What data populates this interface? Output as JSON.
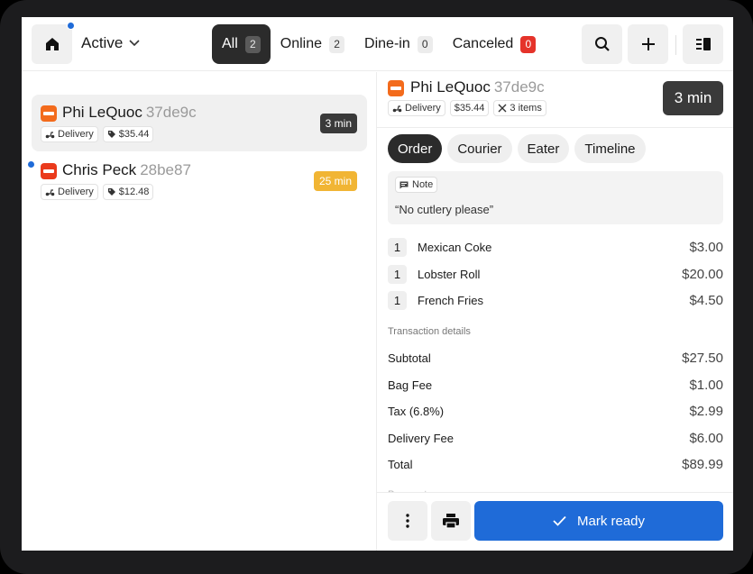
{
  "header": {
    "status_filter": "Active",
    "tabs": [
      {
        "label": "All",
        "count": "2"
      },
      {
        "label": "Online",
        "count": "2"
      },
      {
        "label": "Dine-in",
        "count": "0"
      },
      {
        "label": "Canceled",
        "count": "0"
      }
    ]
  },
  "orders": [
    {
      "name": "Phi LeQuoc",
      "code": "37de9c",
      "type": "Delivery",
      "total": "$35.44",
      "time": "3 min"
    },
    {
      "name": "Chris Peck",
      "code": "28be87",
      "type": "Delivery",
      "total": "$12.48",
      "time": "25 min"
    }
  ],
  "detail": {
    "name": "Phi LeQuoc",
    "code": "37de9c",
    "type": "Delivery",
    "total": "$35.44",
    "items_count": "3 items",
    "time": "3 min",
    "tabs": [
      "Order",
      "Courier",
      "Eater",
      "Timeline"
    ],
    "note_label": "Note",
    "note_text": "“No cutlery please”",
    "items": [
      {
        "qty": "1",
        "name": "Mexican Coke",
        "price": "$3.00"
      },
      {
        "qty": "1",
        "name": "Lobster Roll",
        "price": "$20.00"
      },
      {
        "qty": "1",
        "name": "French Fries",
        "price": "$4.50"
      }
    ],
    "transaction_title": "Transaction details",
    "transactions": [
      {
        "label": "Subtotal",
        "value": "$27.50"
      },
      {
        "label": "Bag Fee",
        "value": "$1.00"
      },
      {
        "label": "Tax (6.8%)",
        "value": "$2.99"
      },
      {
        "label": "Delivery Fee",
        "value": "$6.00"
      },
      {
        "label": "Total",
        "value": "$89.99"
      }
    ],
    "cut_off_heading": "Payment",
    "mark_ready_label": "Mark ready"
  },
  "colors": {
    "accent_blue": "#1f6bd8",
    "brand_orange": "#f36b1c",
    "brand_red": "#ea3a1c",
    "late_yellow": "#f1b534",
    "badge_dark": "#3a3a3a"
  }
}
